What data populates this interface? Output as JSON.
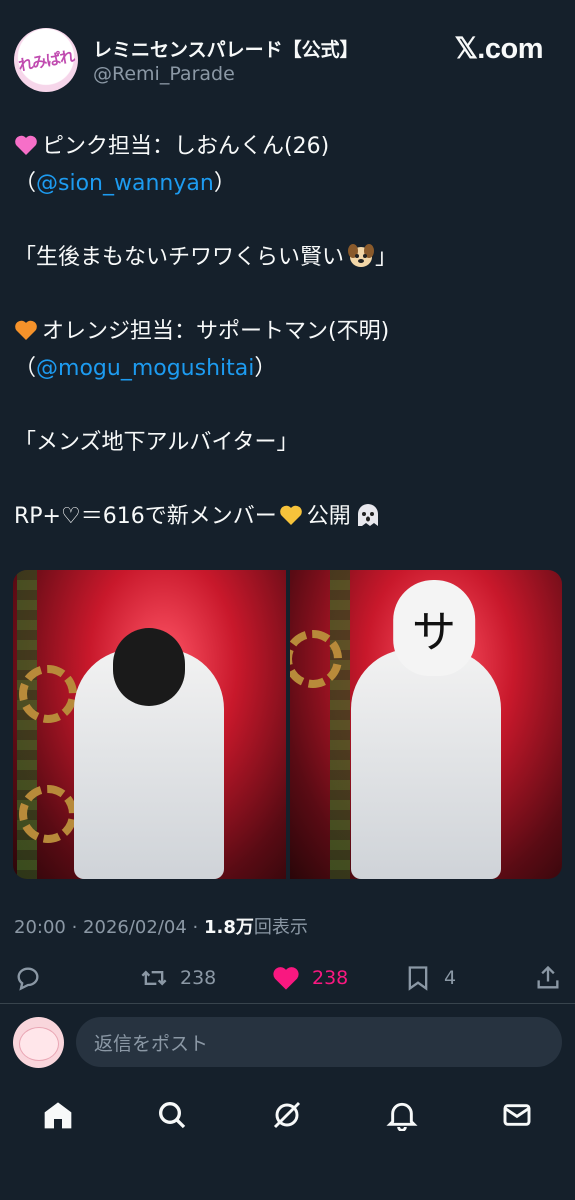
{
  "post": {
    "author_name": "レミニセンスパレード【公式】",
    "author_handle": "@Remi_Parade",
    "site_label": "𝕏.com",
    "avatar_logo": "れみぱれ",
    "body": {
      "line1": "ピンク担当：しおんくん(26)",
      "line2_open": "（",
      "line2_mention": "@sion_wannyan",
      "line2_close": "）",
      "line3": "「生後まもないチワワくらい賢い",
      "line3_end": "」",
      "line4": "オレンジ担当：サポートマン(不明)",
      "line5_open": "（",
      "line5_mention": "@mogu_mogushitai",
      "line5_close": "）",
      "line6": "「メンズ地下アルバイター」",
      "line7_a": "RP+♡＝616で新メンバー",
      "line7_b": "公開"
    },
    "mask_char": "サ",
    "meta": {
      "time_date": "20:00 · 2026/02/04 · ",
      "views": "1.8万",
      "views_suffix": "回表示"
    },
    "actions": {
      "reposts": "238",
      "likes": "238",
      "bookmarks": "4"
    }
  },
  "reply": {
    "placeholder": "返信をポスト"
  },
  "colors": {
    "background": "#15202b",
    "accent": "#1d9bf0",
    "like": "#f91880",
    "muted": "#8b98a5"
  },
  "icons": [
    "reply-icon",
    "repost-icon",
    "like-icon",
    "bookmark-icon",
    "share-icon",
    "home-icon",
    "search-icon",
    "grok-icon",
    "notifications-icon",
    "messages-icon"
  ]
}
